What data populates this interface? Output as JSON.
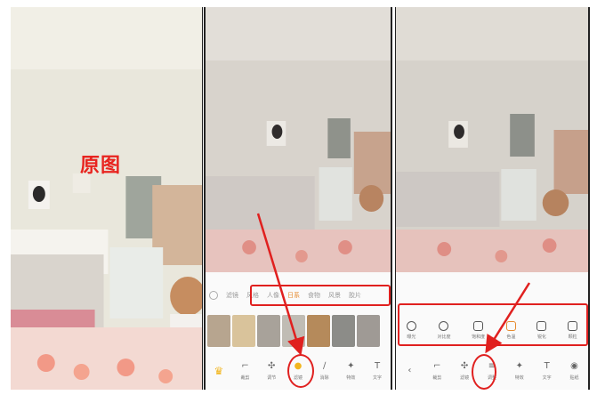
{
  "panels": {
    "original": {
      "label": "原图"
    },
    "filter_editor": {
      "categories": [
        "滤镜",
        "风格",
        "人像",
        "日系",
        "食物",
        "风景",
        "胶片"
      ],
      "active_category": "日系",
      "toolbar": [
        "",
        "裁剪",
        "调节",
        "滤镜",
        "消除",
        "特效",
        "文字"
      ]
    },
    "adjust_editor": {
      "adjust_items": [
        "曝光",
        "对比度",
        "饱和度",
        "色温",
        "锐化",
        "颗粒"
      ],
      "toolbar": [
        "",
        "裁剪",
        "滤镜",
        "调整",
        "特效",
        "文字",
        "贴纸"
      ]
    }
  },
  "colors": {
    "annotation_red": "#e0201f",
    "active_tab": "#e68a2e",
    "crown_gold": "#f2b61f"
  }
}
